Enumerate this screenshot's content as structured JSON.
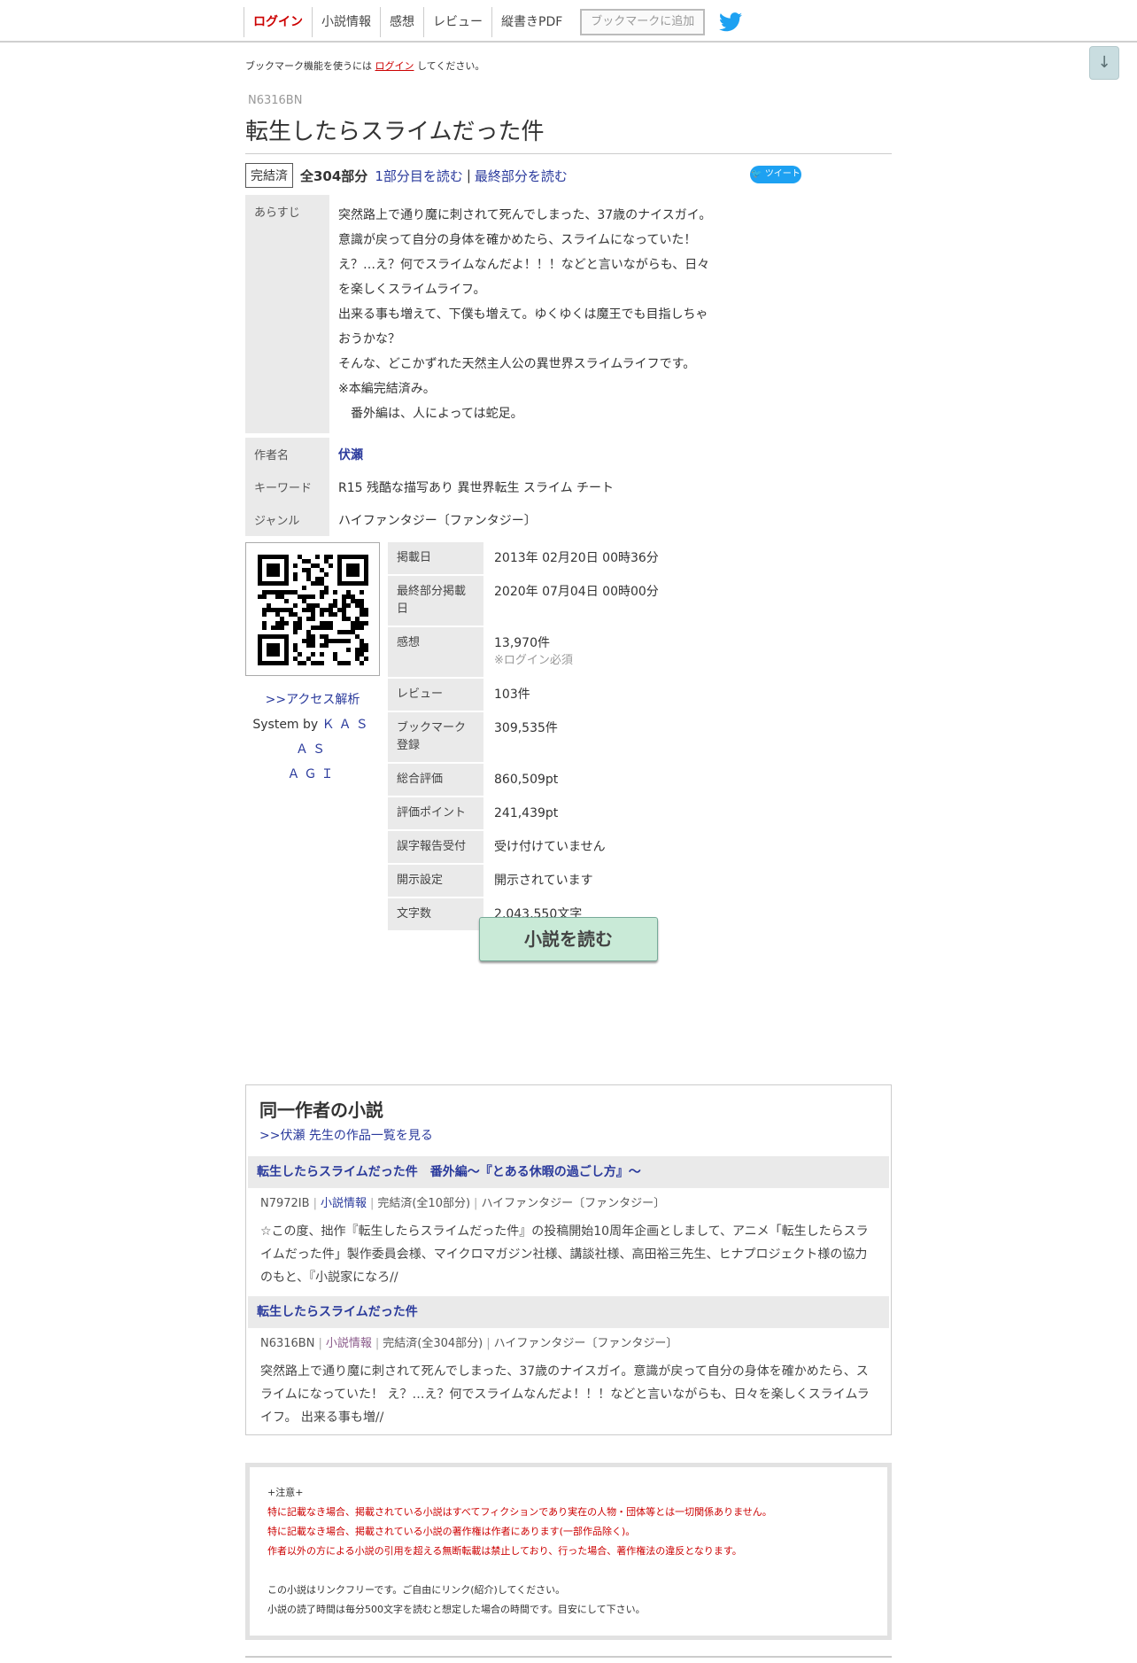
{
  "nav": {
    "login": "ログイン",
    "novel_info": "小説情報",
    "impressions": "感想",
    "review": "レビュー",
    "vertical_pdf": "縦書きPDF",
    "bookmark_add": "ブックマークに追加",
    "twitter_icon": "twitter-icon"
  },
  "scroll_button": "↓",
  "login_note": {
    "prefix": "ブックマーク機能を使うには",
    "link": "ログイン",
    "suffix": "してください。"
  },
  "novel": {
    "ncode": "N6316BN",
    "title": "転生したらスライムだった件",
    "status": "完結済",
    "total_parts": "全304部分",
    "read_first": "1部分目を読む",
    "separator": "|",
    "read_last": "最終部分を読む",
    "tweet": "ツイート"
  },
  "info": {
    "synopsis_label": "あらすじ",
    "synopsis_lines": [
      "突然路上で通り魔に刺されて死んでしまった、37歳のナイスガイ。",
      "意識が戻って自分の身体を確かめたら、スライムになっていた！",
      "え？…え？何でスライムなんだよ！！！などと言いながらも、日々",
      "を楽しくスライムライフ。",
      "出来る事も増えて、下僕も増えて。ゆくゆくは魔王でも目指しちゃ",
      "おうかな？",
      "そんな、どこかずれた天然主人公の異世界スライムライフです。",
      "※本編完結済み。",
      "　番外編は、人によっては蛇足。"
    ],
    "author_label": "作者名",
    "author": "伏瀬",
    "keyword_label": "キーワード",
    "keywords": "R15 残酷な描写あり 異世界転生 スライム チート",
    "genre_label": "ジャンル",
    "genre": "ハイファンタジー〔ファンタジー〕"
  },
  "side": {
    "access": ">>アクセス解析",
    "system_by": "System by",
    "kasasagi_1": "ＫＡＳＡＳ",
    "kasasagi_2": "ＡＧＩ"
  },
  "stats": [
    {
      "label": "掲載日",
      "value": "2013年 02月20日 00時36分",
      "sub": ""
    },
    {
      "label": "最終部分掲載日",
      "value": "2020年 07月04日 00時00分",
      "sub": ""
    },
    {
      "label": "感想",
      "value": "13,970件",
      "sub": "※ログイン必須"
    },
    {
      "label": "レビュー",
      "value": "103件",
      "sub": ""
    },
    {
      "label": "ブックマーク登録",
      "value": "309,535件",
      "sub": ""
    },
    {
      "label": "総合評価",
      "value": "860,509pt",
      "sub": ""
    },
    {
      "label": "評価ポイント",
      "value": "241,439pt",
      "sub": ""
    },
    {
      "label": "誤字報告受付",
      "value": "受け付けていません",
      "sub": ""
    },
    {
      "label": "開示設定",
      "value": "開示されています",
      "sub": ""
    },
    {
      "label": "文字数",
      "value": "2,043,550文字",
      "sub": ""
    }
  ],
  "read_button": "小説を読む",
  "same_author": {
    "title": "同一作者の小説",
    "more": ">>伏瀬 先生の作品一覧を見る",
    "items": [
      {
        "title": "転生したらスライムだった件　番外編～『とある休暇の過ごし方』～",
        "ncode": "N7972IB",
        "info": "小説情報",
        "status": "完結済(全10部分)",
        "genre": "ハイファンタジー〔ファンタジー〕",
        "desc": "☆この度、拙作『転生したらスライムだった件』の投稿開始10周年企画としまして、アニメ「転生したらスライムだった件」製作委員会様、マイクロマガジン社様、講談社様、高田裕三先生、ヒナプロジェクト様の協力のもと、『小説家になろ//"
      },
      {
        "title": "転生したらスライムだった件",
        "ncode": "N6316BN",
        "info": "小説情報",
        "status": "完結済(全304部分)",
        "genre": "ハイファンタジー〔ファンタジー〕",
        "desc": "突然路上で通り魔に刺されて死んでしまった、37歳のナイスガイ。意識が戻って自分の身体を確かめたら、スライムになっていた！ え？…え？何でスライムなんだよ！！！などと言いながらも、日々を楽しくスライムライフ。 出来る事も増//"
      }
    ]
  },
  "notice": {
    "heading": "+注意+",
    "red_lines": [
      "特に記載なき場合、掲載されている小説はすべてフィクションであり実在の人物・団体等とは一切関係ありません。",
      "特に記載なき場合、掲載されている小説の著作権は作者にあります(一部作品除く)。",
      "作者以外の方による小説の引用を超える無断転載は禁止しており、行った場合、著作権法の違反となります。"
    ],
    "normal_lines": [
      "この小説はリンクフリーです。ご自由にリンク(紹介)してください。",
      "小説の読了時間は毎分500文字を読むと想定した場合の時間です。目安にして下さい。"
    ]
  },
  "colors": {
    "link": "#2a3a9c",
    "login_red": "#cc0000",
    "read_button_bg": "#c9ead7",
    "label_bg": "#eaeaea",
    "twitter_blue": "#1da1f2"
  }
}
